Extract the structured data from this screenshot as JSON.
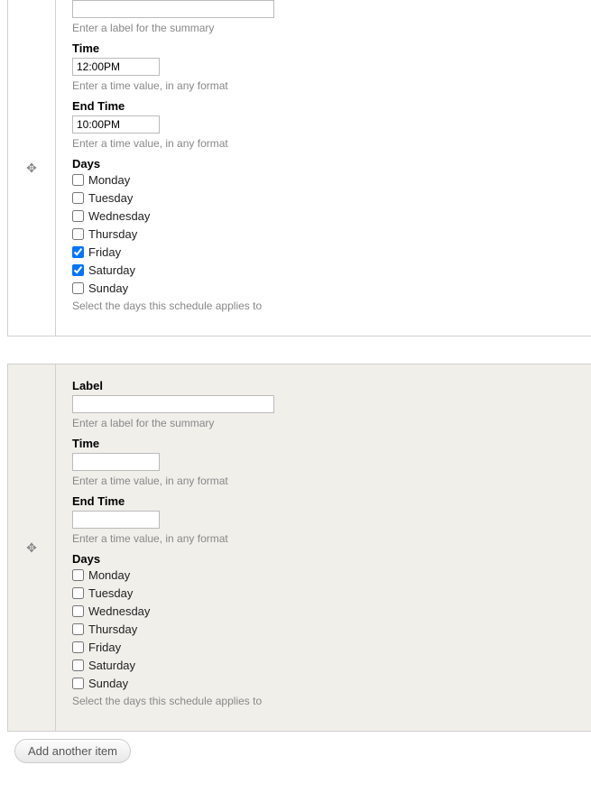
{
  "labels": {
    "label_heading": "Label",
    "label_help": "Enter a label for the summary",
    "time_heading": "Time",
    "time_help": "Enter a time value, in any format",
    "endtime_heading": "End Time",
    "endtime_help": "Enter a time value, in any format",
    "days_heading": "Days",
    "days_help": "Select the days this schedule applies to",
    "add_button": "Add another item"
  },
  "days": [
    "Monday",
    "Tuesday",
    "Wednesday",
    "Thursday",
    "Friday",
    "Saturday",
    "Sunday"
  ],
  "items": [
    {
      "label_value": "",
      "time_value": "12:00PM",
      "endtime_value": "10:00PM",
      "checked": {
        "Monday": false,
        "Tuesday": false,
        "Wednesday": false,
        "Thursday": false,
        "Friday": true,
        "Saturday": true,
        "Sunday": false
      }
    },
    {
      "label_value": "",
      "time_value": "",
      "endtime_value": "",
      "checked": {
        "Monday": false,
        "Tuesday": false,
        "Wednesday": false,
        "Thursday": false,
        "Friday": false,
        "Saturday": false,
        "Sunday": false
      }
    }
  ]
}
